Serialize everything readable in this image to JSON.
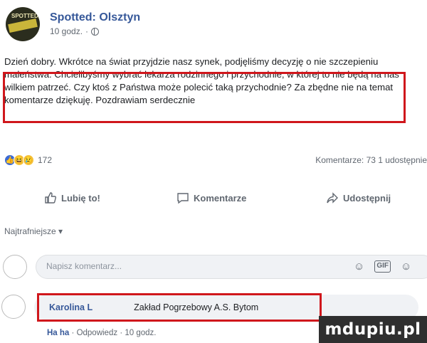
{
  "post": {
    "page_name": "Spotted: Olsztyn",
    "time": "10 godz.",
    "avatar_text": "SPOTTED",
    "text": "Dzień dobry. Wkrótce na świat przyjdzie nasz synek, podjęliśmy decyzję o nie szczepieniu maleństwa. Chcielibyśmy wybrać lekarza rodzinnego i przychodnie, w której to nie będą na nas wilkiem patrzeć. Czy ktoś z Państwa może polecić taką przychodnie? Za zbędne nie na temat komentarze dziękuję. Pozdrawiam serdecznie"
  },
  "reactions": {
    "count": "172",
    "comments": "Komentarze: 73",
    "shares": "1 udostępnie"
  },
  "actions": {
    "like": "Lubię to!",
    "comment": "Komentarze",
    "share": "Udostępnij"
  },
  "sort": {
    "label": "Najtrafniejsze ▾"
  },
  "comment_input": {
    "placeholder": "Napisz komentarz..."
  },
  "comment": {
    "author": "Karolina L",
    "text": "Zakład Pogrzebowy A.S. Bytom",
    "haha": "Ha ha",
    "reply": "Odpowiedz",
    "time": "10 godz."
  },
  "watermark": "mdupiu.pl",
  "colors": {
    "link": "#365899",
    "highlight": "#d0171c",
    "like_reaction": "#3b6bd6",
    "emoji_reaction": "#f5c33b"
  }
}
